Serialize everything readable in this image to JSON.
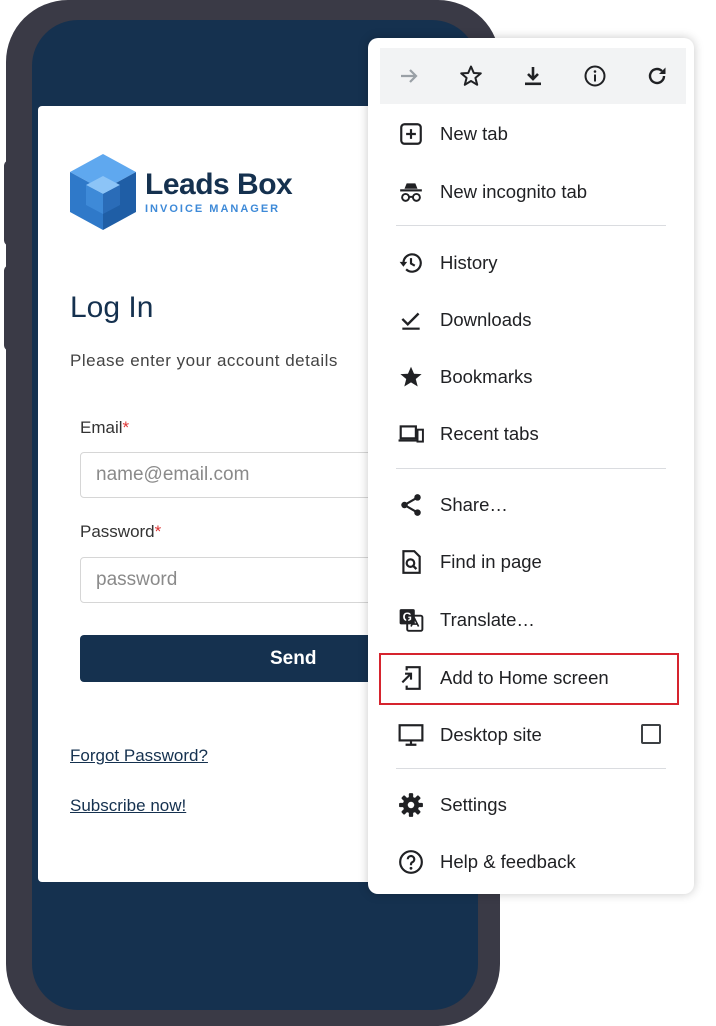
{
  "login": {
    "brand_name": "Leads Box",
    "brand_tagline": "INVOICE MANAGER",
    "title": "Log In",
    "subtitle": "Please enter your account details",
    "email_label": "Email",
    "email_placeholder": "name@email.com",
    "password_label": "Password",
    "password_placeholder": "password",
    "required_mark": "*",
    "send_label": "Send",
    "forgot_link": "Forgot Password?",
    "subscribe_link": "Subscribe now!"
  },
  "menu": {
    "toolbar_icons": [
      "forward-icon",
      "bookmark-star-icon",
      "download-icon",
      "info-icon",
      "reload-icon"
    ],
    "items": [
      {
        "label": "New tab",
        "icon": "new-tab-icon"
      },
      {
        "label": "New incognito tab",
        "icon": "incognito-icon"
      },
      {
        "label": "History",
        "icon": "history-icon"
      },
      {
        "label": "Downloads",
        "icon": "downloads-icon"
      },
      {
        "label": "Bookmarks",
        "icon": "bookmarks-icon"
      },
      {
        "label": "Recent tabs",
        "icon": "recent-tabs-icon"
      },
      {
        "label": "Share…",
        "icon": "share-icon"
      },
      {
        "label": "Find in page",
        "icon": "find-in-page-icon"
      },
      {
        "label": "Translate…",
        "icon": "translate-icon"
      },
      {
        "label": "Add to Home screen",
        "icon": "add-to-home-screen-icon",
        "highlighted": true
      },
      {
        "label": "Desktop site",
        "icon": "desktop-icon",
        "checkbox_checked": false
      },
      {
        "label": "Settings",
        "icon": "settings-gear-icon"
      },
      {
        "label": "Help & feedback",
        "icon": "help-icon"
      }
    ]
  },
  "colors": {
    "brand_navy": "#15314f",
    "brand_blue": "#3e8ad8",
    "highlight_red": "#d6242e",
    "phone_frame": "#3a3a46"
  }
}
